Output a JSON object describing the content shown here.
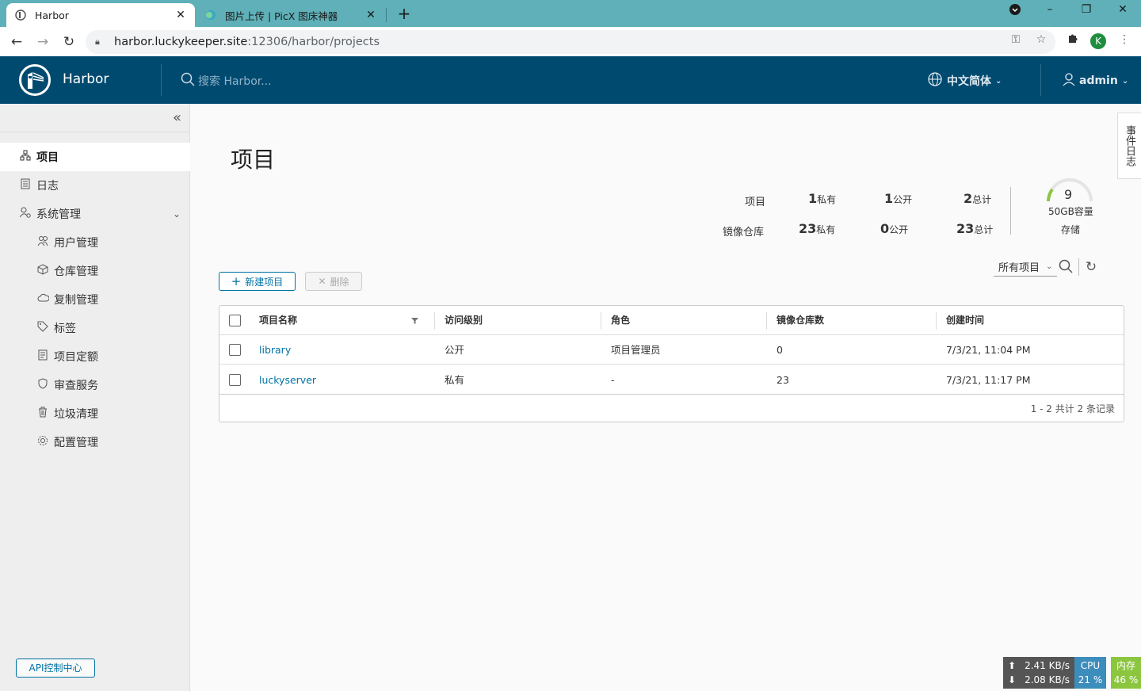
{
  "browser": {
    "tabs": [
      {
        "title": "Harbor",
        "active": true
      },
      {
        "title": "图片上传 | PicX 图床神器",
        "active": false
      }
    ],
    "url_host": "harbor.luckykeeper.site",
    "url_path": ":12306/harbor/projects",
    "profile_initial": "K"
  },
  "header": {
    "brand": "Harbor",
    "search_placeholder": "搜索 Harbor...",
    "language": "中文简体",
    "user": "admin",
    "color": "#004a70"
  },
  "sidebar": {
    "items": [
      {
        "label": "项目",
        "icon": "project-icon",
        "active": true
      },
      {
        "label": "日志",
        "icon": "log-icon"
      },
      {
        "label": "系统管理",
        "icon": "admin-icon",
        "expanded": true
      }
    ],
    "sub_items": [
      {
        "label": "用户管理",
        "icon": "users-icon"
      },
      {
        "label": "仓库管理",
        "icon": "box-icon"
      },
      {
        "label": "复制管理",
        "icon": "cloud-icon"
      },
      {
        "label": "标签",
        "icon": "tag-icon"
      },
      {
        "label": "项目定额",
        "icon": "quota-icon"
      },
      {
        "label": "审查服务",
        "icon": "shield-icon"
      },
      {
        "label": "垃圾清理",
        "icon": "trash-icon"
      },
      {
        "label": "配置管理",
        "icon": "gear-icon"
      }
    ],
    "api_button": "API控制中心"
  },
  "main": {
    "title": "项目",
    "side_tab": "事件日志",
    "stats": {
      "projects_label": "项目",
      "repos_label": "镜像仓库",
      "projects_private": "1",
      "projects_public": "1",
      "projects_total": "2",
      "repos_private": "23",
      "repos_public": "0",
      "repos_total": "23",
      "private_suffix": "私有",
      "public_suffix": "公开",
      "total_suffix": "总计",
      "storage_count": "9",
      "storage_capacity": "50GB容量",
      "storage_label": "存储"
    },
    "toolbar": {
      "new_project": "新建项目",
      "delete": "删除",
      "filter": "所有项目"
    },
    "table": {
      "columns": [
        "项目名称",
        "访问级别",
        "角色",
        "镜像仓库数",
        "创建时间"
      ],
      "rows": [
        {
          "name": "library",
          "access": "公开",
          "role": "项目管理员",
          "repos": "0",
          "created": "7/3/21, 11:04 PM"
        },
        {
          "name": "luckyserver",
          "access": "私有",
          "role": "-",
          "repos": "23",
          "created": "7/3/21, 11:17 PM"
        }
      ],
      "footer": "1 - 2 共计 2 条记录"
    }
  },
  "netmon": {
    "up": "2.41 KB/s",
    "down": "2.08 KB/s",
    "cpu_label": "CPU",
    "cpu_value": "21 %",
    "mem_label": "内存",
    "mem_value": "46 %"
  }
}
